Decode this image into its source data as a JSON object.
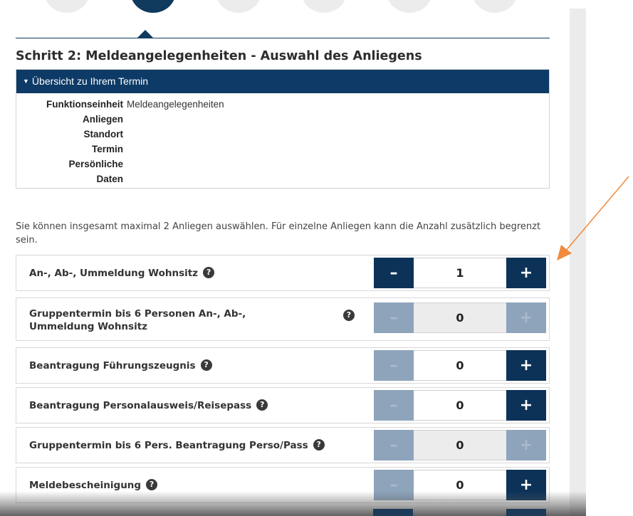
{
  "page_title": "Schritt 2: Meldeangelegenheiten - Auswahl des Anliegens",
  "overview": {
    "header": "Übersicht zu Ihrem Termin",
    "fields": [
      {
        "label": "Funktionseinheit",
        "value": "Meldeangelegenheiten"
      },
      {
        "label": "Anliegen",
        "value": ""
      },
      {
        "label": "Standort",
        "value": ""
      },
      {
        "label": "Termin",
        "value": ""
      },
      {
        "label": "Persönliche",
        "value": ""
      },
      {
        "label": "Daten",
        "value": ""
      }
    ]
  },
  "info_text": "Sie können insgesamt maximal 2 Anliegen auswählen. Für einzelne Anliegen kann die Anzahl zusätzlich begrenzt sein.",
  "stepper_symbols": {
    "minus": "–",
    "plus": "+",
    "help": "?"
  },
  "services": [
    {
      "line1": "An-, Ab-, Ummeldung Wohnsitz",
      "line2": "",
      "quantity": "1",
      "minus_enabled": true,
      "plus_enabled": true
    },
    {
      "line1": "Gruppentermin bis 6 Personen An-, Ab-,",
      "line2": "Ummeldung Wohnsitz",
      "quantity": "0",
      "minus_enabled": false,
      "plus_enabled": false
    },
    {
      "line1": "Beantragung Führungszeugnis",
      "line2": "",
      "quantity": "0",
      "minus_enabled": false,
      "plus_enabled": true
    },
    {
      "line1": "Beantragung Personalausweis/Reisepass",
      "line2": "",
      "quantity": "0",
      "minus_enabled": false,
      "plus_enabled": true
    },
    {
      "line1": "Gruppentermin bis 6 Pers. Beantragung Perso/Pass",
      "line2": "",
      "quantity": "0",
      "minus_enabled": false,
      "plus_enabled": false
    },
    {
      "line1": "Meldebescheinigung",
      "line2": "",
      "quantity": "0",
      "minus_enabled": false,
      "plus_enabled": true
    }
  ],
  "colors": {
    "primary": "#0d3258",
    "header": "#0d3a66",
    "disabled": "#8ea4bb",
    "annotation_arrow": "#f08a3c"
  }
}
